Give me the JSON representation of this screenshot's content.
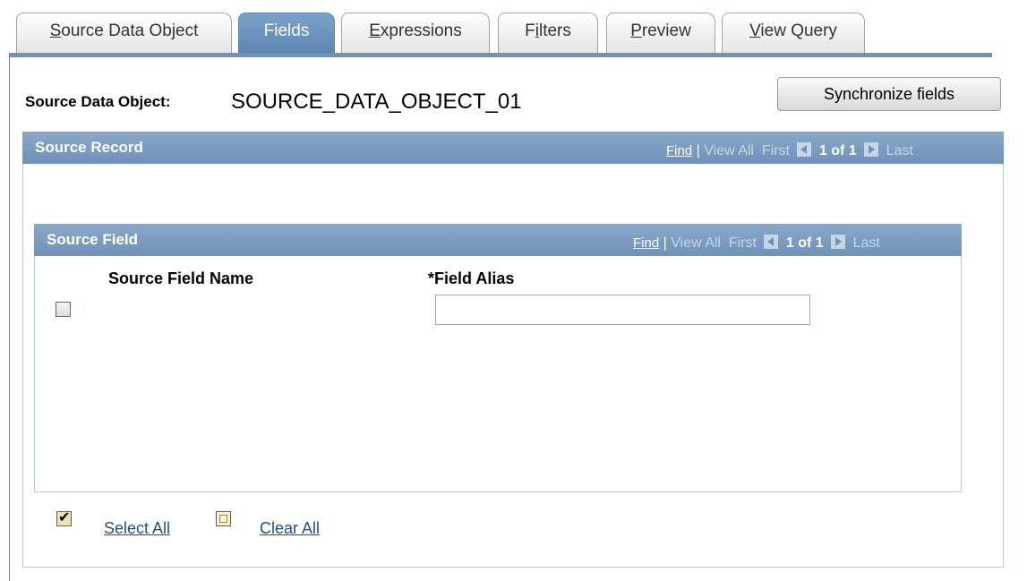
{
  "tabs": [
    {
      "label": "Source Data Object",
      "ul": "S",
      "rest": "ource Data Object",
      "active": false
    },
    {
      "label": "Fields",
      "active": true
    },
    {
      "label": "Expressions",
      "ul": "E",
      "rest": "xpressions",
      "active": false
    },
    {
      "label": "Filters",
      "pre": "F",
      "ul": "i",
      "rest": "lters",
      "active": false
    },
    {
      "label": "Preview",
      "ul": "P",
      "rest": "review",
      "active": false
    },
    {
      "label": "View Query",
      "ul": "V",
      "rest": "iew Query",
      "active": false
    }
  ],
  "header": {
    "source_data_object_label": "Source Data Object:",
    "source_data_object_value": "SOURCE_DATA_OBJECT_01",
    "sync_button": "Synchronize fields"
  },
  "source_record": {
    "title": "Source Record",
    "find": "Find",
    "separator": "|",
    "view_all": "View All",
    "first": "First",
    "count": "1 of 1",
    "last": "Last"
  },
  "source_field": {
    "title": "Source Field",
    "find": "Find",
    "separator": "|",
    "view_all": "View All",
    "first": "First",
    "count": "1 of 1",
    "last": "Last",
    "columns": {
      "name": "Source Field Name",
      "alias": "*Field Alias"
    },
    "row": {
      "selected": false,
      "alias_value": ""
    }
  },
  "footer": {
    "select_all": "Select All",
    "clear_all": "Clear All"
  },
  "colors": {
    "tab_active": "#5b84b0",
    "grid_header": "#6f92ba",
    "link": "#244e8b"
  }
}
